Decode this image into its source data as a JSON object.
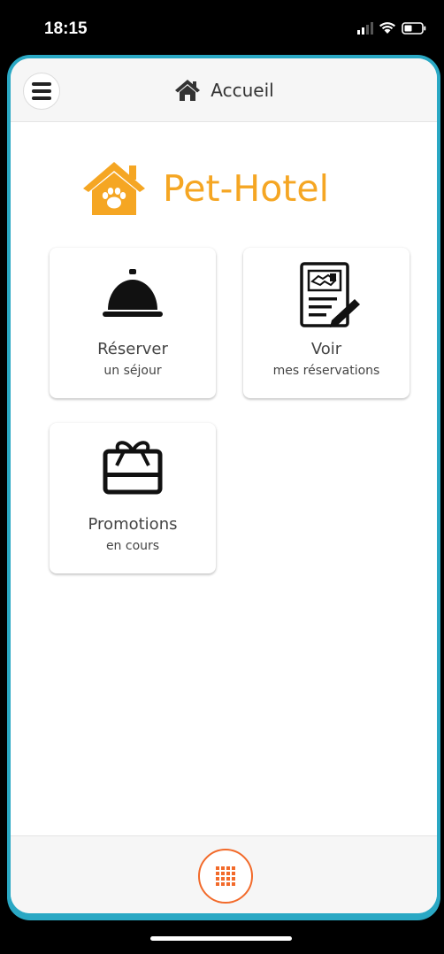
{
  "status_bar": {
    "time": "18:15"
  },
  "header": {
    "title": "Accueil",
    "icon": "home-icon"
  },
  "brand": {
    "name": "Pet-Hotel",
    "color": "#f5a623",
    "icon": "house-paw-icon"
  },
  "cards": [
    {
      "line1": "Réserver",
      "line2": "un séjour",
      "icon": "service-bell-icon"
    },
    {
      "line1": "Voir",
      "line2": "mes réservations",
      "icon": "contract-handshake-icon"
    },
    {
      "line1": "Promotions",
      "line2": "en cours",
      "icon": "gift-card-icon"
    }
  ],
  "footer": {
    "icon": "grid-menu-icon",
    "accent": "#f26a2a"
  },
  "colors": {
    "frame": "#2aa8c4",
    "bar_bg": "#f6f6f6"
  }
}
